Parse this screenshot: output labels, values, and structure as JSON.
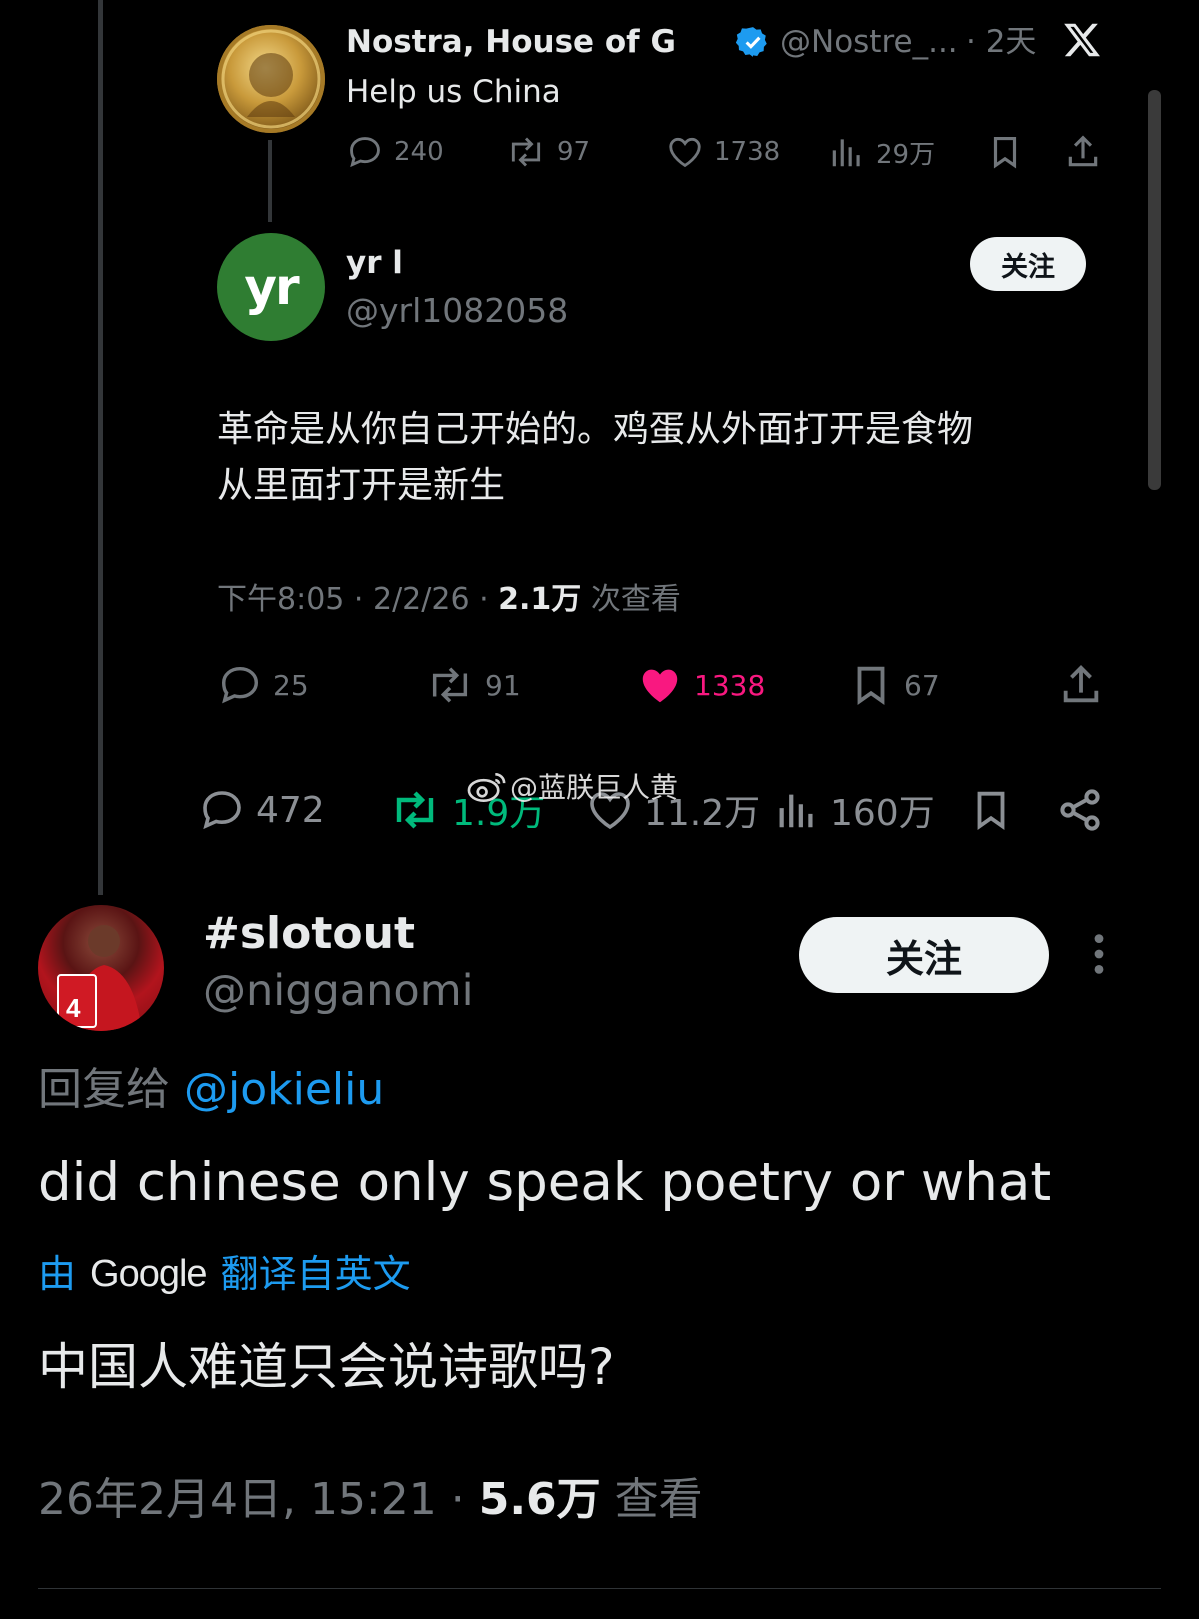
{
  "quoted_post": {
    "name": "Nostra, House of G",
    "handle": "@Nostre_...",
    "time": "· 2天",
    "text": "Help us China",
    "stats": {
      "replies": "240",
      "reposts": "97",
      "likes": "1738",
      "views": "29万"
    }
  },
  "reply_post": {
    "name": "yr l",
    "handle": "@yrl1082058",
    "avatar_text": "yr",
    "follow_label": "关注",
    "text_line1": "革命是从你自己开始的。鸡蛋从外面打开是食物",
    "text_line2": "从里面打开是新生",
    "meta_time": "下午8:05 · 2/2/26 · ",
    "meta_views_count": "2.1万",
    "meta_views_label": " 次查看",
    "stats": {
      "replies": "25",
      "reposts": "91",
      "likes": "1338",
      "bookmarks": "67"
    }
  },
  "outer_stats": {
    "replies": "472",
    "reposts": "1.9万",
    "likes": "11.2万",
    "views": "160万"
  },
  "watermark": "@蓝朕巨人黄",
  "main_post": {
    "name": "#slotout",
    "handle": "@nigganomi",
    "follow_label": "关注",
    "reply_to_prefix": "回复给 ",
    "reply_to_handle": "@jokieliu",
    "text": "did chinese only speak poetry or what",
    "translate_prefix": "由",
    "translate_brand": "Google",
    "translate_suffix": "翻译自英文",
    "translated_text": "中国人难道只会说诗歌吗?",
    "meta_time": "26年2月4日, 15:21 · ",
    "meta_views_count": "5.6万",
    "meta_views_label": " 查看"
  },
  "colors": {
    "background": "#000000",
    "text": "#e7e9ea",
    "muted": "#71767b",
    "link_blue": "#1d9bf0",
    "like_pink": "#f91880",
    "repost_green": "#00ba7c",
    "verified_blue": "#1d9bf0"
  },
  "icons": [
    "x-logo-icon",
    "verified-badge-icon",
    "reply-icon",
    "repost-icon",
    "like-icon",
    "views-icon",
    "bookmark-icon",
    "share-icon",
    "more-icon",
    "weibo-icon"
  ]
}
